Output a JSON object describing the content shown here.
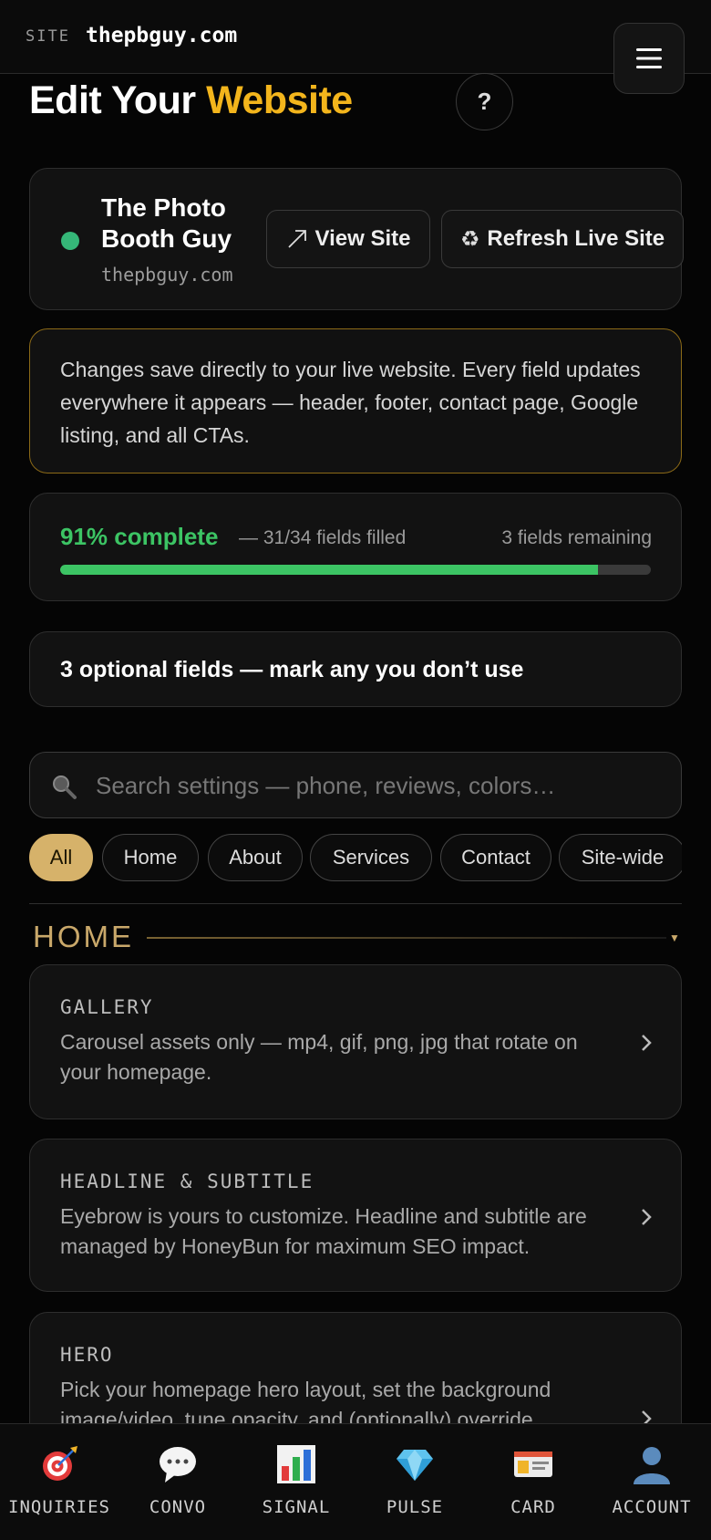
{
  "topbar": {
    "site_label": "SITE",
    "site_domain": "thepbguy.com"
  },
  "page": {
    "title_prefix": "Edit Your ",
    "title_accent": "Website",
    "help_label": "?"
  },
  "site_card": {
    "name": "The Photo Booth Guy",
    "domain": "thepbguy.com",
    "status_color": "#35b778",
    "view_label": "View Site",
    "refresh_label": "Refresh Live Site"
  },
  "notice": {
    "text": "Changes save directly to your live website. Every field updates everywhere it appears — header, footer, contact page, Google listing, and all CTAs."
  },
  "progress": {
    "percent_label": "91% complete",
    "filled_label": "— 31/34 fields filled",
    "remaining_label": "3 fields remaining",
    "fraction": 0.91
  },
  "optional": {
    "label": "3 optional fields — mark any you don’t use"
  },
  "search": {
    "placeholder": "Search settings — phone, reviews, colors…",
    "value": ""
  },
  "filters": [
    {
      "label": "All",
      "active": true
    },
    {
      "label": "Home",
      "active": false
    },
    {
      "label": "About",
      "active": false
    },
    {
      "label": "Services",
      "active": false
    },
    {
      "label": "Contact",
      "active": false
    },
    {
      "label": "Site-wide",
      "active": false
    }
  ],
  "section": {
    "title": "HOME",
    "items": [
      {
        "title": "GALLERY",
        "desc": "Carousel assets only — mp4, gif, png, jpg that rotate on your homepage."
      },
      {
        "title": "HEADLINE & SUBTITLE",
        "desc": "Eyebrow is yours to customize. Headline and subtitle are managed by HoneyBun for maximum SEO impact."
      },
      {
        "title": "HERO",
        "desc": "Pick your homepage hero layout, set the background image/video, tune opacity, and (optionally) override"
      }
    ]
  },
  "bottom_nav": [
    {
      "label": "INQUIRIES",
      "icon": "target-icon"
    },
    {
      "label": "CONVO",
      "icon": "chat-icon"
    },
    {
      "label": "SIGNAL",
      "icon": "bar-chart-icon"
    },
    {
      "label": "PULSE",
      "icon": "gem-icon"
    },
    {
      "label": "CARD",
      "icon": "id-card-icon"
    },
    {
      "label": "ACCOUNT",
      "icon": "user-icon"
    }
  ],
  "colors": {
    "accent_gold": "#f3b51c",
    "section_gold": "#c9a86a",
    "progress_green": "#3cc464"
  }
}
